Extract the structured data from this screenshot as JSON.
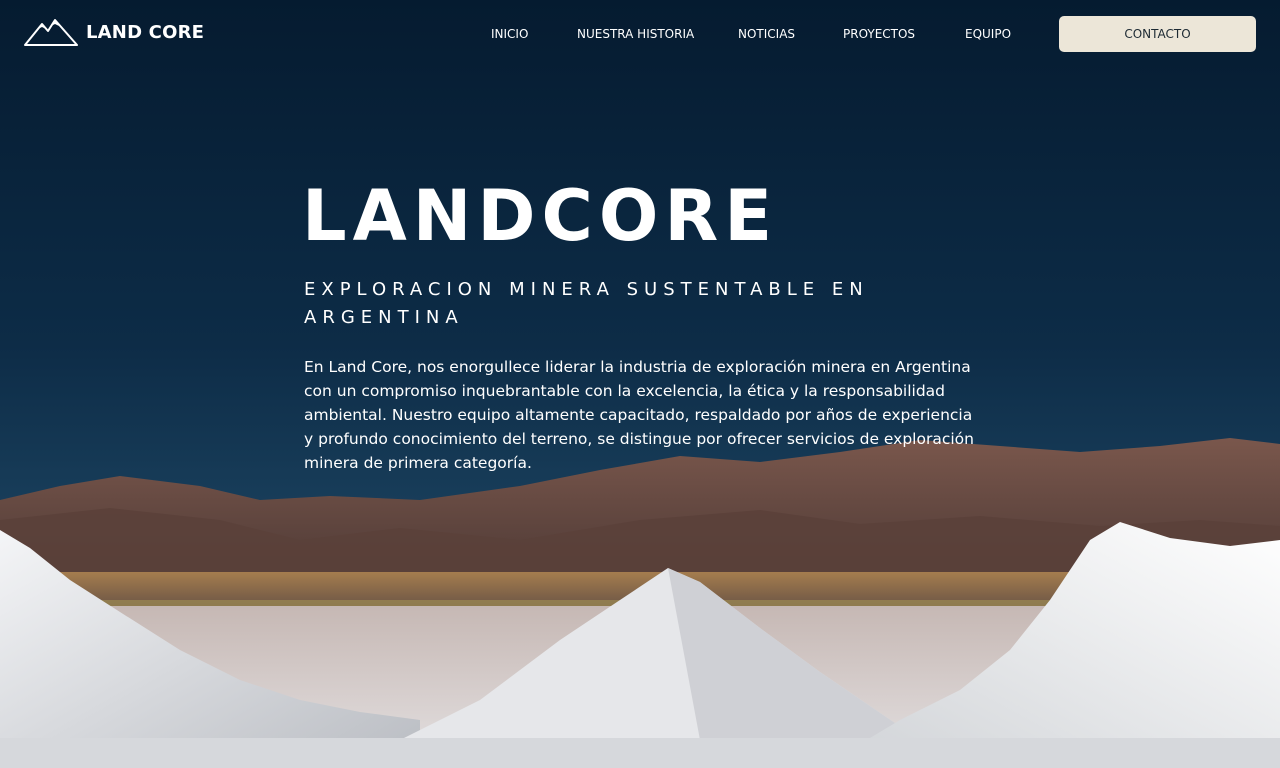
{
  "brand": {
    "name": "LAND CORE",
    "icon": "mountain-logo-icon"
  },
  "nav": {
    "items": [
      {
        "label": "INICIO"
      },
      {
        "label": "NUESTRA HISTORIA"
      },
      {
        "label": "NOTICIAS"
      },
      {
        "label": "PROYECTOS"
      },
      {
        "label": "EQUIPO"
      }
    ],
    "contact_label": "CONTACTO"
  },
  "hero": {
    "title": "LANDCORE",
    "subtitle": "EXPLORACION MINERA SUSTENTABLE EN ARGENTINA",
    "description": "En Land Core, nos enorgullece liderar la industria de exploración minera en Argentina con un compromiso inquebrantable con la excelencia, la ética y la responsabilidad ambiental. Nuestro equipo altamente capacitado, respaldado por años de experiencia y profundo conocimiento del terreno, se distingue por ofrecer servicios de exploración minera de primera categoría."
  },
  "colors": {
    "sky_top": "#051d34",
    "sky_bottom": "#1e4663",
    "mountains": "#6a4a40",
    "salt": "#e9ecef",
    "contact_bg": "#ece6d8",
    "contact_text": "#1d2a33"
  }
}
